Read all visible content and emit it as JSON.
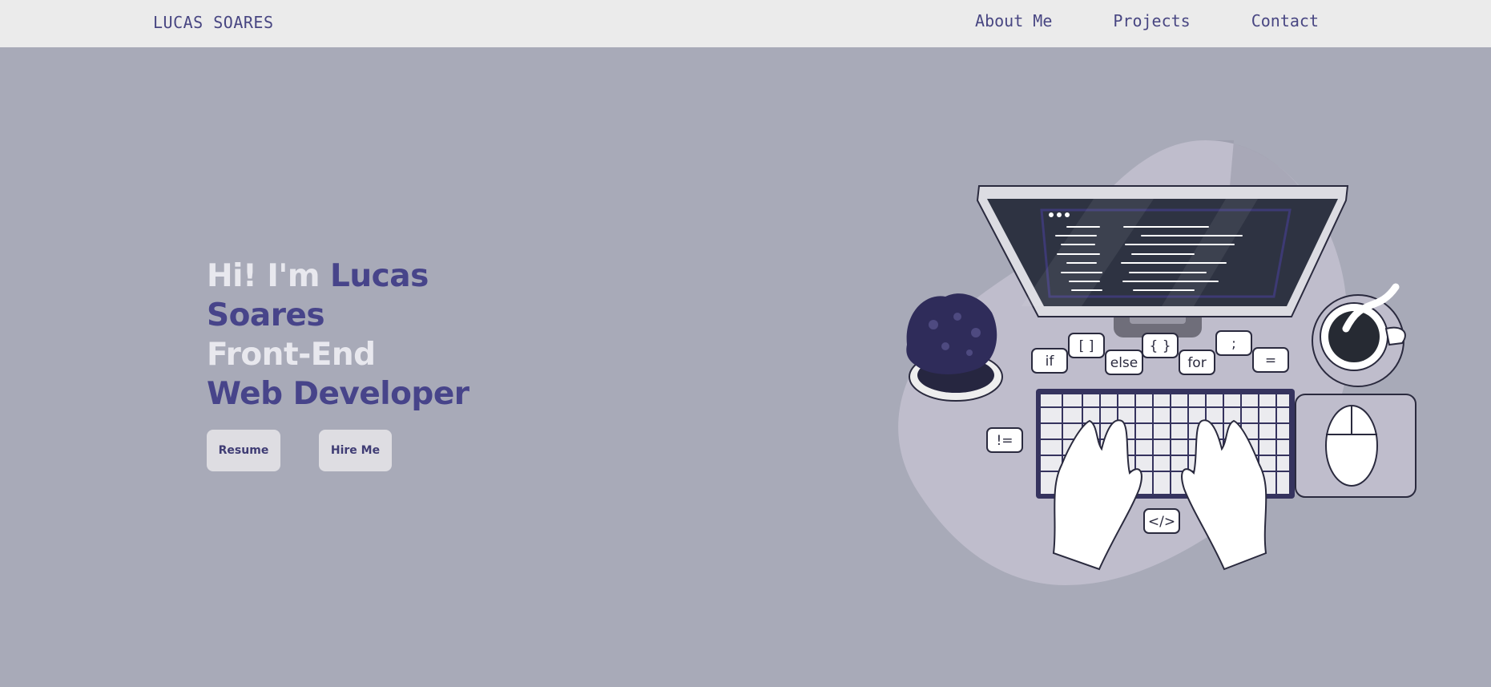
{
  "nav": {
    "brand": "LUCAS SOARES",
    "links": [
      "About Me",
      "Projects",
      "Contact"
    ]
  },
  "hero": {
    "greeting": "Hi! I'm ",
    "first_name": "Lucas",
    "last_name": "Soares",
    "role_line1": "Front-End",
    "role_line2": "Web Developer",
    "buttons": {
      "resume": "Resume",
      "hire": "Hire Me"
    }
  },
  "illustration": {
    "bubbles": [
      "if",
      "[ ]",
      "else",
      "{ }",
      "for",
      ";",
      "=",
      "!=",
      "</>"
    ]
  },
  "colors": {
    "background": "#a8aab8",
    "navbar": "#ebebeb",
    "accent": "#47448a",
    "light_text": "#e8e8ee",
    "button": "#dedde2"
  }
}
